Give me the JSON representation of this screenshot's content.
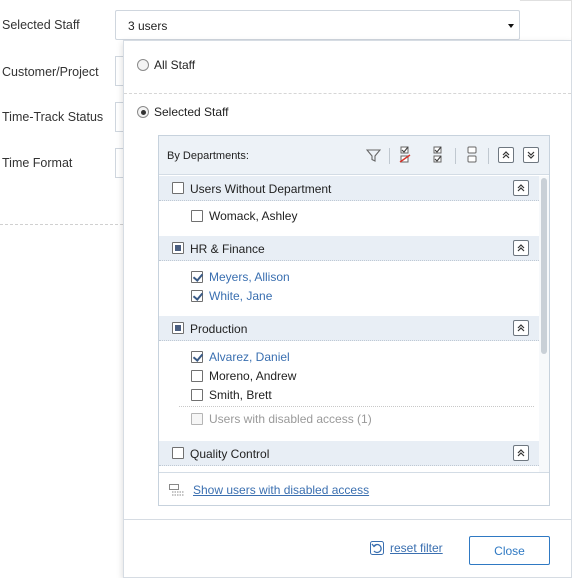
{
  "form": {
    "labels": [
      "Selected Staff",
      "Customer/Project",
      "Time-Track Status",
      "Time Format"
    ]
  },
  "select": {
    "value": "3 users"
  },
  "popup": {
    "radio_all": "All Staff",
    "radio_selected": "Selected Staff",
    "selected_option": "Selected Staff",
    "panel_title": "By Departments:",
    "toolbar_icons": [
      "filter-icon",
      "uncheck-all-icon",
      "check-all-icon",
      "collapse-all-icon",
      "expand-all-button",
      "collapse-all-button"
    ],
    "groups": [
      {
        "label": "Users Without Department",
        "state": "unchecked",
        "users": [
          {
            "name": "Womack, Ashley",
            "checked": false
          }
        ]
      },
      {
        "label": "HR & Finance",
        "state": "partial",
        "users": [
          {
            "name": "Meyers, Allison",
            "checked": true
          },
          {
            "name": "White, Jane",
            "checked": true
          }
        ]
      },
      {
        "label": "Production",
        "state": "partial",
        "users": [
          {
            "name": "Alvarez, Daniel",
            "checked": true
          },
          {
            "name": "Moreno, Andrew",
            "checked": false
          },
          {
            "name": "Smith, Brett",
            "checked": false
          }
        ],
        "disabled_note": "Users with disabled access (1)"
      },
      {
        "label": "Quality Control",
        "state": "unchecked",
        "users": []
      }
    ],
    "show_disabled_link": "Show users with disabled access",
    "reset_label": "reset filter",
    "close_label": "Close"
  },
  "colors": {
    "accent": "#2f79c3",
    "link": "#3a6fb0",
    "header_bg": "#edf2f7",
    "group_bg": "#e8eef5"
  }
}
